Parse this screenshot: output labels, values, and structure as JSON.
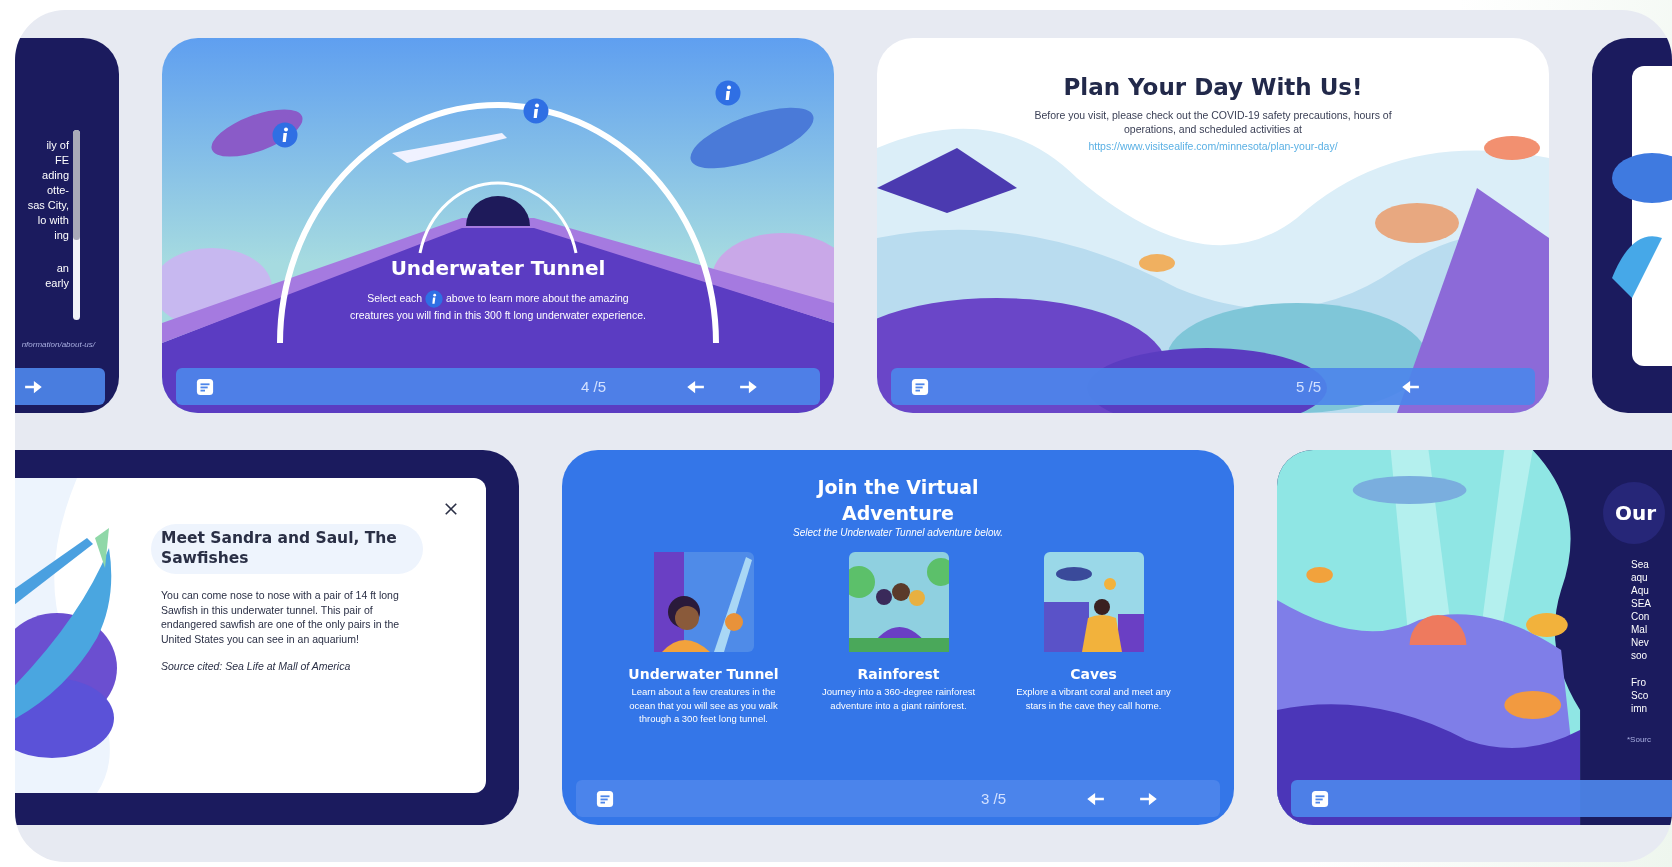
{
  "top_row": [
    {
      "kind": "text_panel",
      "paragraphs": [
        [
          "ily of",
          "FE",
          "ading",
          "otte-",
          "sas City,",
          "lo with",
          "ing"
        ],
        [
          "an",
          "early"
        ]
      ],
      "source": "nformation/about-us/",
      "nav": {
        "notes": false,
        "back": false,
        "next": true
      }
    },
    {
      "kind": "tunnel",
      "title": "Underwater Tunnel",
      "text_before": "Select each",
      "text_after": "above to learn more about the amazing creatures you will find in this 300 ft long underwater experience.",
      "nav": {
        "notes": true,
        "counter": "4 /5",
        "back": true,
        "next": true
      }
    },
    {
      "kind": "plan",
      "title": "Plan Your Day With Us!",
      "text": "Before you visit, please check out the COVID-19 safety precautions, hours of operations, and scheduled activities at",
      "link": "https://www.visitsealife.com/minnesota/plan-your-day/",
      "nav": {
        "notes": true,
        "counter": "5 /5",
        "back": true,
        "next": false
      }
    },
    {
      "kind": "picture_panel"
    }
  ],
  "bottom_row": [
    {
      "kind": "modal",
      "title": "Meet Sandra and Saul, The Sawfishes",
      "text": "You can come nose to nose with a pair of 14 ft long Sawfish in this underwater tunnel. This pair of endangered sawfish are one of the only pairs in the United States you can see in an aquarium!",
      "source": "Source cited: Sea Life at Mall of America"
    },
    {
      "kind": "adventure",
      "title": "Join the Virtual Adventure",
      "subtitle": "Select the Underwater Tunnel adventure below.",
      "options": [
        {
          "title": "Underwater Tunnel",
          "text": "Learn about a few creatures in the ocean that you will see as you walk through a 300 feet long tunnel."
        },
        {
          "title": "Rainforest",
          "text": "Journey into a 360-degree rainforest adventure into a giant rainforest."
        },
        {
          "title": "Caves",
          "text": "Explore a vibrant coral and meet any stars in the cave they call home."
        }
      ],
      "nav": {
        "notes": true,
        "counter": "3 /5",
        "back": true,
        "next": true
      }
    },
    {
      "kind": "about",
      "title": "Our",
      "paragraphs": [
        [
          "Sea",
          "aqu",
          "Aqu",
          "SEA",
          "Con",
          "Mal",
          "Nev",
          "soo"
        ],
        [
          "Fro",
          "Sco",
          "imn"
        ]
      ],
      "source": "*Sourc",
      "nav": {
        "notes": true,
        "back": false,
        "next": false
      }
    }
  ]
}
